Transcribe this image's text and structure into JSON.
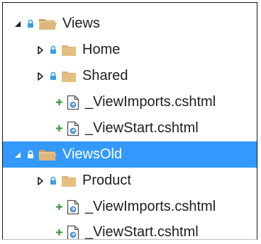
{
  "tree": {
    "nodes": [
      {
        "label": "Views",
        "kind": "folder",
        "expander": "expanded",
        "decorator": "lock",
        "selected": false,
        "depth": 0,
        "open": true
      },
      {
        "label": "Home",
        "kind": "folder",
        "expander": "collapsed",
        "decorator": "lock",
        "selected": false,
        "depth": 1,
        "open": false
      },
      {
        "label": "Shared",
        "kind": "folder",
        "expander": "collapsed",
        "decorator": "lock",
        "selected": false,
        "depth": 1,
        "open": false
      },
      {
        "label": "_ViewImports.cshtml",
        "kind": "file",
        "expander": "none",
        "decorator": "add",
        "selected": false,
        "depth": 1,
        "open": false
      },
      {
        "label": "_ViewStart.cshtml",
        "kind": "file",
        "expander": "none",
        "decorator": "add",
        "selected": false,
        "depth": 1,
        "open": false
      },
      {
        "label": "ViewsOld",
        "kind": "folder",
        "expander": "expanded",
        "decorator": "lock",
        "selected": true,
        "depth": 0,
        "open": true
      },
      {
        "label": "Product",
        "kind": "folder",
        "expander": "collapsed",
        "decorator": "lock",
        "selected": false,
        "depth": 1,
        "open": false
      },
      {
        "label": "_ViewImports.cshtml",
        "kind": "file",
        "expander": "none",
        "decorator": "add",
        "selected": false,
        "depth": 1,
        "open": false
      },
      {
        "label": "_ViewStart.cshtml",
        "kind": "file",
        "expander": "none",
        "decorator": "add",
        "selected": false,
        "depth": 1,
        "open": false
      }
    ]
  },
  "icons": {
    "expanded": "caret-expanded-icon",
    "collapsed": "caret-collapsed-icon",
    "lock": "lock-icon",
    "add": "pending-add-icon",
    "folder": "folder-icon",
    "folder_open": "folder-open-icon",
    "file": "cshtml-file-icon"
  },
  "colors": {
    "selection": "#3399ff",
    "text": "#1e1e1e",
    "folder": "#dcb67a",
    "lock": "#3a9de0",
    "add": "#3c9a3c"
  }
}
